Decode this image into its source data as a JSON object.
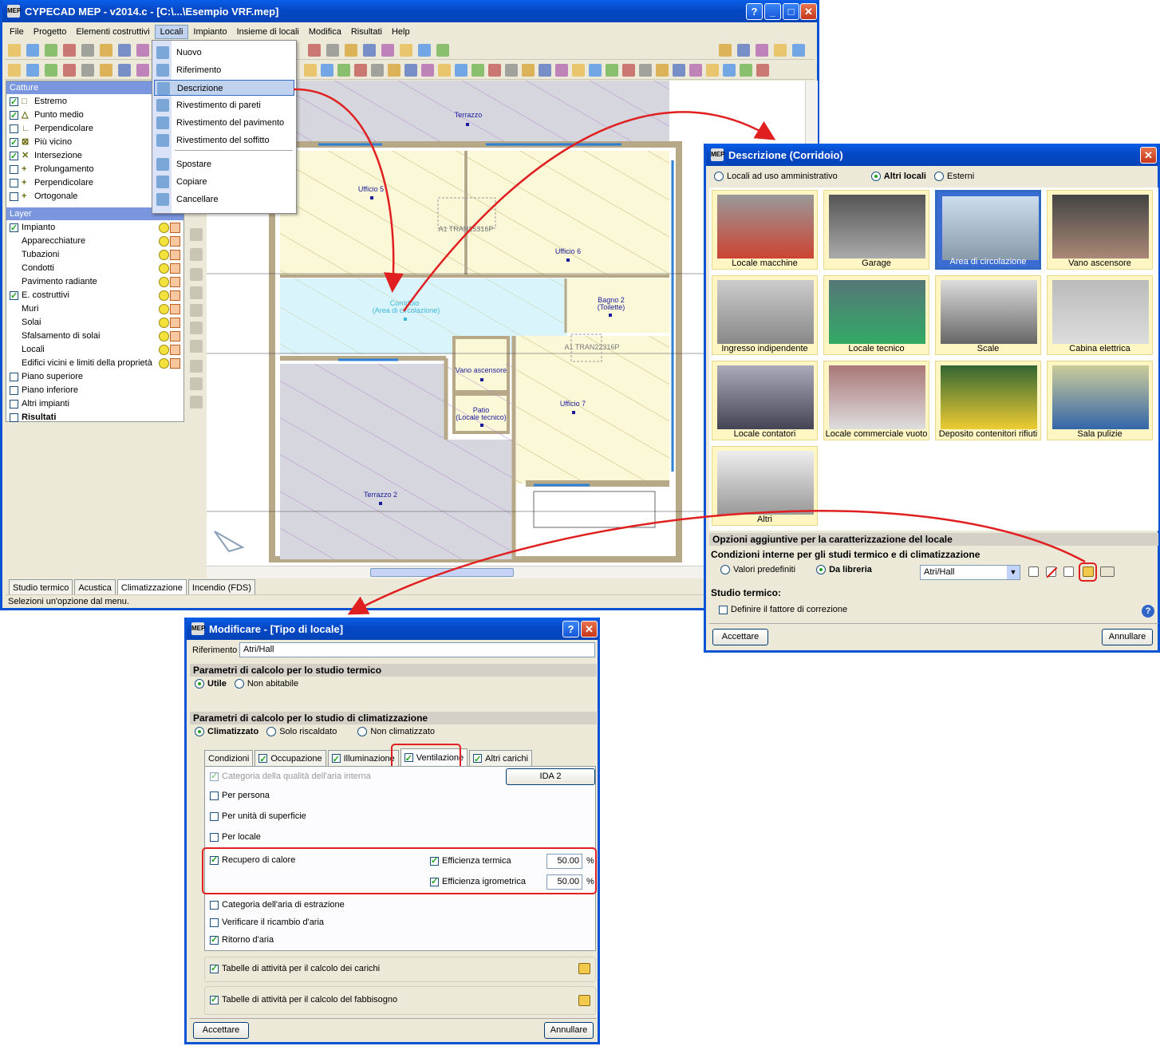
{
  "main": {
    "title": "CYPECAD MEP - v2014.c - [C:\\...\\Esempio VRF.mep]",
    "menu": [
      "File",
      "Progetto",
      "Elementi costruttivi",
      "Locali",
      "Impianto",
      "Insieme di locali",
      "Modifica",
      "Risultati",
      "Help"
    ],
    "status": "Selezioni un'opzione dal menu.",
    "catture_title": "Catture",
    "catture": [
      {
        "label": "Estremo",
        "checked": true
      },
      {
        "label": "Punto medio",
        "checked": true
      },
      {
        "label": "Perpendicolare",
        "checked": false
      },
      {
        "label": "Più vicino",
        "checked": true
      },
      {
        "label": "Intersezione",
        "checked": true
      },
      {
        "label": "Prolungamento",
        "checked": false
      },
      {
        "label": "Perpendicolare",
        "checked": false
      },
      {
        "label": "Ortogonale",
        "checked": false
      }
    ],
    "layer_title": "Layer",
    "layers": [
      {
        "label": "Impianto",
        "checked": true,
        "indent": false,
        "dots": true
      },
      {
        "label": "Apparecchiature",
        "checked": null,
        "indent": true,
        "dots": true
      },
      {
        "label": "Tubazioni",
        "checked": null,
        "indent": true,
        "dots": true
      },
      {
        "label": "Condotti",
        "checked": null,
        "indent": true,
        "dots": true
      },
      {
        "label": "Pavimento radiante",
        "checked": null,
        "indent": true,
        "dots": true
      },
      {
        "label": "E. costruttivi",
        "checked": true,
        "indent": false,
        "dots": true
      },
      {
        "label": "Muri",
        "checked": null,
        "indent": true,
        "dots": true
      },
      {
        "label": "Solai",
        "checked": null,
        "indent": true,
        "dots": true
      },
      {
        "label": "Sfalsamento di solai",
        "checked": null,
        "indent": true,
        "dots": true
      },
      {
        "label": "Locali",
        "checked": null,
        "indent": true,
        "dots": true
      },
      {
        "label": "Edifici vicini e limiti della proprietà",
        "checked": null,
        "indent": true,
        "dots": true
      },
      {
        "label": "Piano superiore",
        "checked": false,
        "indent": false,
        "dots": false
      },
      {
        "label": "Piano inferiore",
        "checked": false,
        "indent": false,
        "dots": false
      },
      {
        "label": "Altri impianti",
        "checked": false,
        "indent": false,
        "dots": false
      },
      {
        "label": "Risultati",
        "checked": false,
        "indent": false,
        "dots": false,
        "bold": true
      }
    ],
    "bottom_tabs": [
      "Studio termico",
      "Acustica",
      "Climatizzazione",
      "Incendio (FDS)"
    ],
    "locali_menu": [
      "Nuovo",
      "Riferimento",
      "Descrizione",
      "Rivestimento di pareti",
      "Rivestimento del pavimento",
      "Rivestimento del soffitto",
      "Spostare",
      "Copiare",
      "Cancellare"
    ],
    "plan": {
      "rooms": [
        "Terrazzo",
        "Ufficio 5",
        "Ufficio 6",
        "Corridoio",
        "(Area di circolazione)",
        "Bagno 2",
        "(Toilette)",
        "Vano ascensore",
        "Patio",
        "(Locale tecnico)",
        "Ufficio 7",
        "Terrazzo 2"
      ],
      "unit1": "A1 TRAN15316P",
      "unit2": "A1 TRAN22316P"
    }
  },
  "desc": {
    "title": "Descrizione (Corridoio)",
    "radios": [
      {
        "label": "Locali ad uso amministrativo",
        "on": false
      },
      {
        "label": "Altri locali",
        "on": true
      },
      {
        "label": "Esterni",
        "on": false
      }
    ],
    "tiles": [
      "Locale macchine",
      "Garage",
      "Area di circolazione",
      "Vano ascensore",
      "Ingresso indipendente",
      "Locale tecnico",
      "Scale",
      "Cabina elettrica",
      "Locale contatori",
      "Locale commerciale vuoto",
      "Deposito contenitori rifiuti",
      "Sala pulizie",
      "Altri"
    ],
    "opt_title": "Opzioni aggiuntive per la caratterizzazione del locale",
    "cond_title": "Condizioni interne per gli studi termico e di climatizzazione",
    "radio_predef": "Valori predefiniti",
    "radio_lib": "Da libreria",
    "select_value": "Atri/Hall",
    "studio_title": "Studio termico:",
    "fattore": "Definire il fattore di correzione",
    "ok": "Accettare",
    "cancel": "Annullare"
  },
  "mod": {
    "title": "Modificare - [Tipo di locale]",
    "ref_label": "Riferimento",
    "ref_value": "Atri/Hall",
    "sec1": "Parametri di calcolo per lo studio termico",
    "r_utile": "Utile",
    "r_nonab": "Non abitabile",
    "sec2": "Parametri di calcolo per lo studio di climatizzazione",
    "r_clim": "Climatizzato",
    "r_risc": "Solo riscaldato",
    "r_nonclim": "Non climatizzato",
    "tabs": [
      "Condizioni",
      "Occupazione",
      "Illuminazione",
      "Ventilazione",
      "Altri carichi"
    ],
    "cat_qual": "Categoria della qualità dell'aria interna",
    "ida": "IDA 2",
    "per_persona": "Per persona",
    "per_sup": "Per unità di superficie",
    "per_locale": "Per locale",
    "recupero": "Recupero di calore",
    "eff_term": "Efficienza termica",
    "eff_term_val": "50.00",
    "eff_igro": "Efficienza igrometrica",
    "eff_igro_val": "50.00",
    "pct": "%",
    "cat_estr": "Categoria dell'aria di estrazione",
    "verif": "Verificare il ricambio d'aria",
    "ritorno": "Ritorno d'aria",
    "tab_carichi": "Tabelle di attività per il calcolo dei carichi",
    "tab_fabb": "Tabelle di attività per il calcolo del fabbisogno",
    "ok": "Accettare",
    "cancel": "Annullare"
  },
  "colors": {
    "xp_blue": "#0a53d5",
    "accent_red": "#e02020",
    "tile_bg": "#fff6c4",
    "corridor": "#d9f5fb",
    "room": "#fbf8d8"
  }
}
